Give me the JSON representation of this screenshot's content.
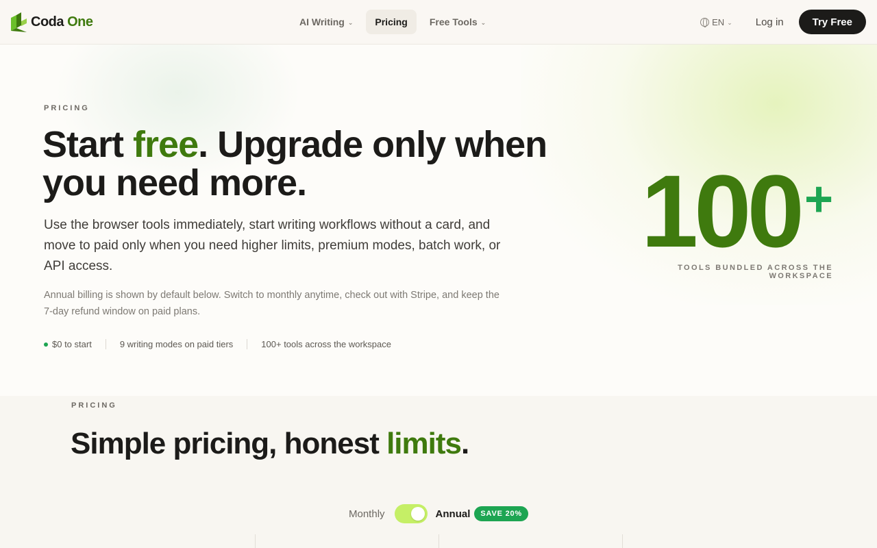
{
  "nav": {
    "logo": {
      "word1": "Coda",
      "word2": "One"
    },
    "items": [
      {
        "label": "AI Writing",
        "has_dropdown": true,
        "active": false
      },
      {
        "label": "Pricing",
        "has_dropdown": false,
        "active": true
      },
      {
        "label": "Free Tools",
        "has_dropdown": true,
        "active": false
      }
    ],
    "language": "EN",
    "login": "Log in",
    "cta": "Try Free"
  },
  "hero": {
    "eyebrow": "PRICING",
    "title": {
      "part1": "Start ",
      "highlight": "free",
      "part2": ". Upgrade only when you need more."
    },
    "lead": "Use the browser tools immediately, start writing workflows without a card, and move to paid only when you need higher limits, premium modes, batch work, or API access.",
    "sub": "Annual billing is shown by default below. Switch to monthly anytime, check out with Stripe, and keep the 7-day refund window on paid plans.",
    "chips": [
      "$0 to start",
      "9 writing modes on paid tiers",
      "100+ tools across the workspace"
    ],
    "stat": {
      "number": "100",
      "suffix": "+",
      "caption": "TOOLS BUNDLED ACROSS THE WORKSPACE"
    }
  },
  "pricing": {
    "eyebrow": "PRICING",
    "title": {
      "part1": "Simple pricing, honest ",
      "highlight": "limits",
      "part2": "."
    },
    "billing": {
      "monthly": "Monthly",
      "annual": "Annual",
      "annual_selected": true,
      "badge": "SAVE 20%"
    }
  },
  "colors": {
    "brand_green": "#3f7a0e",
    "accent_green": "#1da552",
    "toggle": "#c5ef66",
    "ink": "#1c1b19"
  }
}
